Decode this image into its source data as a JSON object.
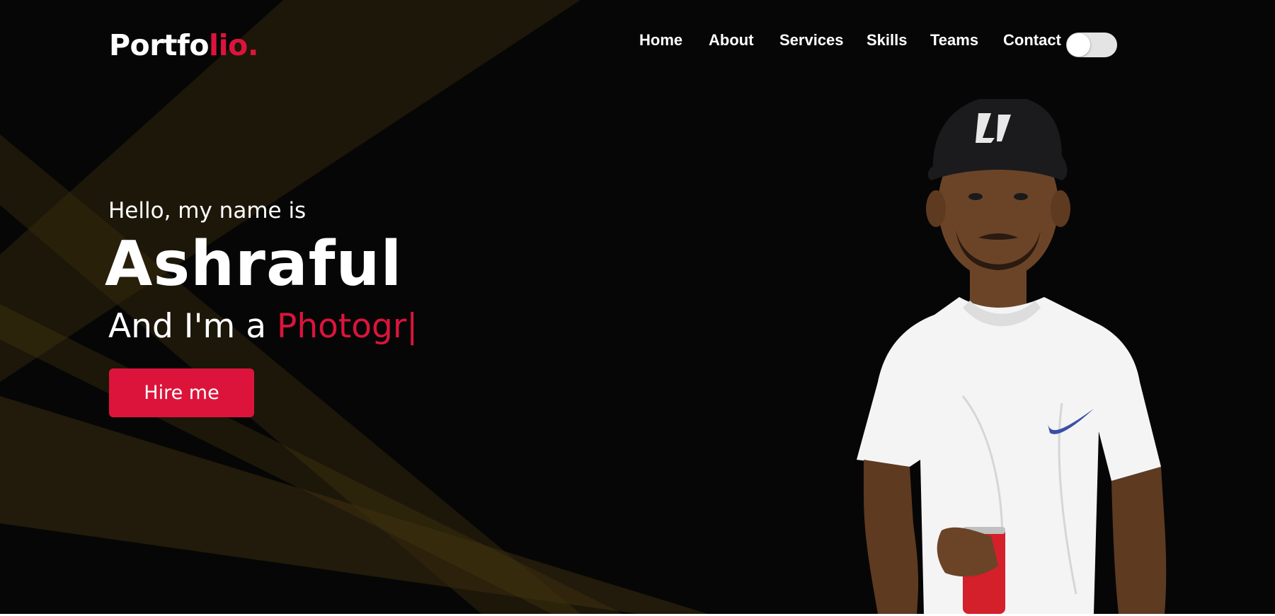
{
  "logo": {
    "main": "Portfo",
    "accent": "lio."
  },
  "nav": {
    "items": [
      "Home",
      "About",
      "Services",
      "Skills",
      "Teams",
      "Contact"
    ]
  },
  "theme_toggle": {
    "state": "off"
  },
  "hero": {
    "greeting": "Hello, my name is",
    "name": "Ashraful",
    "role_prefix": "And I'm a",
    "role_typed": "Photogr",
    "cursor": "|",
    "hire_button": "Hire me"
  },
  "colors": {
    "accent": "#dc143c",
    "background": "#060606",
    "text": "#ffffff",
    "rays": "#3a2c0e"
  },
  "icons": {
    "theme_toggle": "toggle-switch-icon",
    "portrait": "person-photo"
  }
}
